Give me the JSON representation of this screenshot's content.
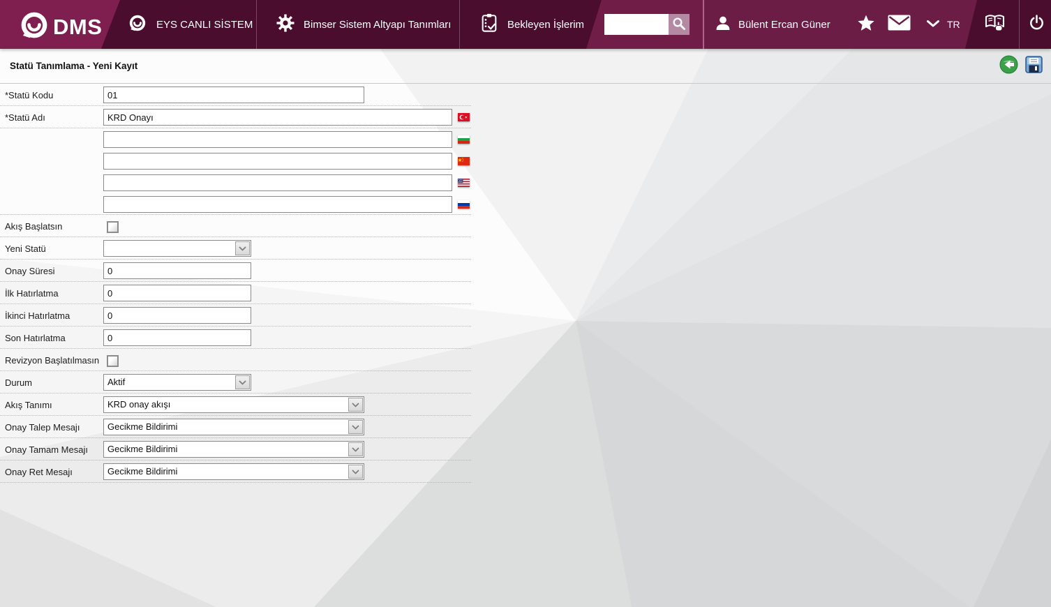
{
  "topbar": {
    "brand_text": "DMS",
    "menu": {
      "eys": "EYS CANLI SİSTEM",
      "bimser": "Bimser Sistem Altyapı Tanımları",
      "bekleyen": "Bekleyen İşlerim"
    },
    "search": {
      "value": ""
    },
    "user_name": "Bülent Ercan Güner",
    "language": "TR"
  },
  "header": {
    "title": "Statü Tanımlama - Yeni Kayıt"
  },
  "form": {
    "fields": {
      "statu_kodu": {
        "label": "*Statü Kodu",
        "value": "01"
      },
      "statu_adi": {
        "label": "*Statü Adı",
        "values": {
          "tr": "KRD Onayı",
          "bg": "",
          "cn": "",
          "en": "",
          "ru": ""
        }
      },
      "akis_baslatsin": {
        "label": "Akış Başlatsın",
        "checked": false
      },
      "yeni_statu": {
        "label": "Yeni Statü",
        "value": ""
      },
      "onay_suresi": {
        "label": "Onay Süresi",
        "value": "0"
      },
      "ilk_hatirlatma": {
        "label": "İlk Hatırlatma",
        "value": "0"
      },
      "ikinci_hatirlatma": {
        "label": "İkinci Hatırlatma",
        "value": "0"
      },
      "son_hatirlatma": {
        "label": "Son Hatırlatma",
        "value": "0"
      },
      "revizyon_baslatilmasin": {
        "label": "Revizyon Başlatılmasın",
        "checked": false
      },
      "durum": {
        "label": "Durum",
        "value": "Aktif"
      },
      "akis_tanimi": {
        "label": "Akış Tanımı",
        "value": "KRD onay akışı"
      },
      "onay_talep_mesaji": {
        "label": "Onay Talep Mesajı",
        "value": "Gecikme Bildirimi"
      },
      "onay_tamam_mesaji": {
        "label": "Onay Tamam Mesajı",
        "value": "Gecikme Bildirimi"
      },
      "onay_ret_mesaji": {
        "label": "Onay Ret Mesajı",
        "value": "Gecikme Bildirimi"
      }
    },
    "flags": [
      "turkey",
      "bulgaria",
      "china",
      "usa",
      "russia"
    ]
  },
  "colors": {
    "bar_dark": "#4a0d2d",
    "bar_logo": "#7e1f4f",
    "bar_search": "#701e47",
    "bar_user": "#6c1d45",
    "search_button": "#b389a3",
    "back_icon_green": "#3aa148",
    "save_icon_blue": "#7aa8d6"
  }
}
